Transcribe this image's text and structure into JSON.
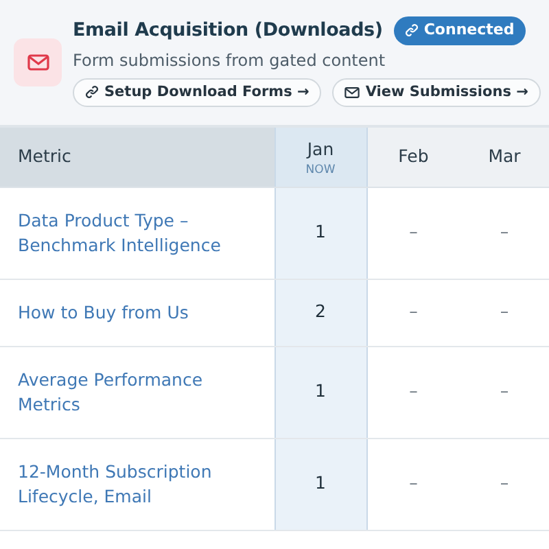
{
  "header": {
    "title": "Email Acquisition (Downloads)",
    "status": "Connected",
    "subtitle": "Form submissions from gated content",
    "actions": [
      {
        "label": "Setup Download Forms →",
        "kind": "link"
      },
      {
        "label": "View Submissions →",
        "kind": "mail"
      }
    ]
  },
  "table": {
    "columns": [
      {
        "label": "Metric",
        "selected": false
      },
      {
        "label": "Jan",
        "sublabel": "NOW",
        "selected": true
      },
      {
        "label": "Feb",
        "selected": false
      },
      {
        "label": "Mar",
        "selected": false
      }
    ],
    "rows": [
      {
        "metric": "Data Product Type – Benchmark Intelligence",
        "values": [
          "1",
          "–",
          "–"
        ]
      },
      {
        "metric": "How to Buy from Us",
        "values": [
          "2",
          "–",
          "–"
        ]
      },
      {
        "metric": "Average Performance Metrics",
        "values": [
          "1",
          "–",
          "–"
        ]
      },
      {
        "metric": "12-Month Subscription Lifecycle, Email",
        "values": [
          "1",
          "–",
          "–"
        ]
      }
    ]
  }
}
